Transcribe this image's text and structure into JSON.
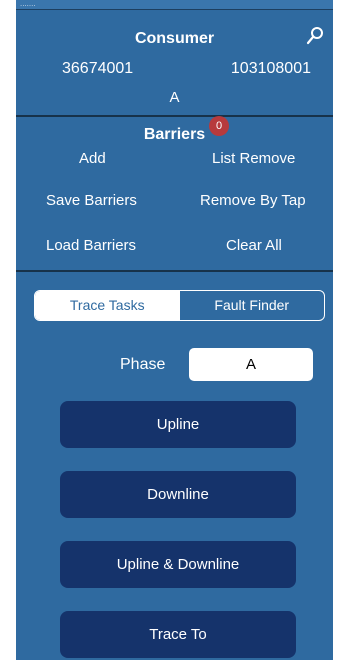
{
  "topstrip": {
    "text": "......."
  },
  "consumer": {
    "title": "Consumer",
    "left_id": "36674001",
    "right_id": "103108001",
    "phase": "A"
  },
  "barriers": {
    "title": "Barriers",
    "badge_count": "0",
    "add": "Add",
    "list_remove": "List Remove",
    "save": "Save Barriers",
    "remove_by_tap": "Remove By Tap",
    "load": "Load Barriers",
    "clear_all": "Clear All"
  },
  "tabs": [
    {
      "label": "Trace Tasks",
      "active": true
    },
    {
      "label": "Fault Finder",
      "active": false
    }
  ],
  "phase": {
    "label": "Phase",
    "value": "A"
  },
  "actions": [
    {
      "label": "Upline"
    },
    {
      "label": "Downline"
    },
    {
      "label": "Upline & Downline"
    },
    {
      "label": "Trace To"
    }
  ],
  "colors": {
    "panel": "#2f6aa0",
    "button": "#15336b",
    "badge": "#b73a3d",
    "divider": "#17324a"
  }
}
